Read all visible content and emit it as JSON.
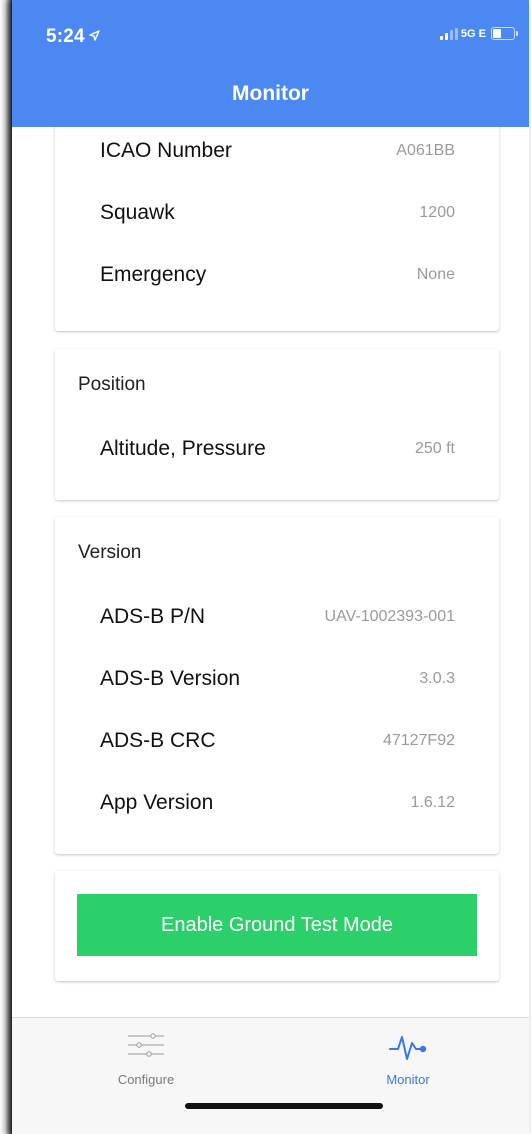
{
  "status_bar": {
    "time": "5:24",
    "network": "5G E"
  },
  "header": {
    "title": "Monitor"
  },
  "transponder_card": {
    "rows": [
      {
        "label": "ICAO Number",
        "value": "A061BB"
      },
      {
        "label": "Squawk",
        "value": "1200"
      },
      {
        "label": "Emergency",
        "value": "None"
      }
    ]
  },
  "position_card": {
    "title": "Position",
    "rows": [
      {
        "label": "Altitude, Pressure",
        "value": "250 ft"
      }
    ]
  },
  "version_card": {
    "title": "Version",
    "rows": [
      {
        "label": "ADS-B P/N",
        "value": "UAV-1002393-001"
      },
      {
        "label": "ADS-B Version",
        "value": "3.0.3"
      },
      {
        "label": "ADS-B CRC",
        "value": "47127F92"
      },
      {
        "label": "App Version",
        "value": "1.6.12"
      }
    ]
  },
  "actions": {
    "ground_test_label": "Enable Ground Test Mode"
  },
  "tabbar": {
    "tabs": [
      {
        "label": "Configure",
        "icon": "sliders-icon",
        "active": false
      },
      {
        "label": "Monitor",
        "icon": "pulse-icon",
        "active": true
      }
    ]
  },
  "colors": {
    "header": "#4b88f1",
    "button": "#2cd06a",
    "active_tab": "#3b78e7",
    "inactive_tab": "#8e8e93"
  }
}
